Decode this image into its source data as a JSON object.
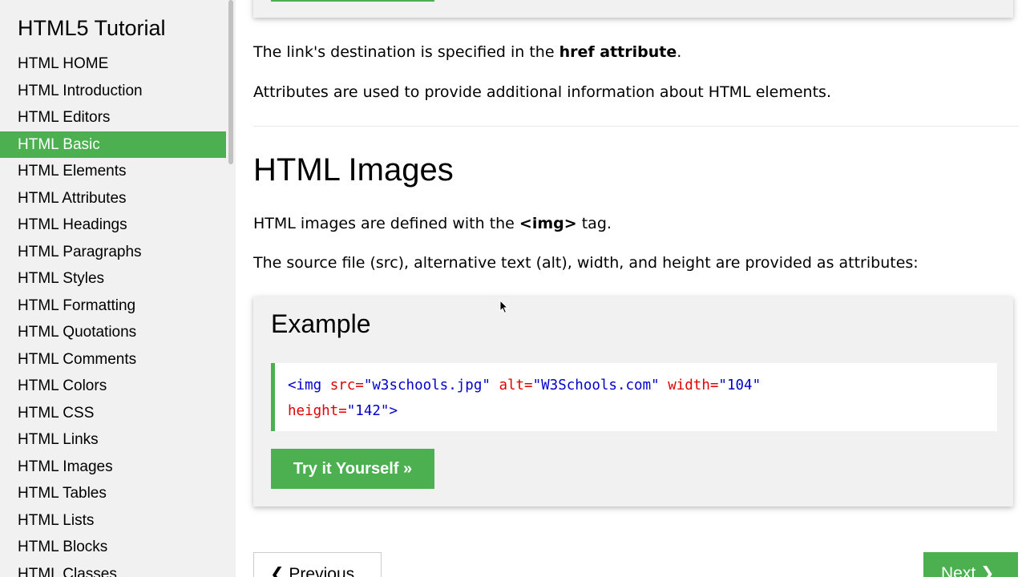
{
  "sidebar": {
    "title": "HTML5 Tutorial",
    "items": [
      {
        "label": "HTML HOME"
      },
      {
        "label": "HTML Introduction"
      },
      {
        "label": "HTML Editors"
      },
      {
        "label": "HTML Basic",
        "active": true
      },
      {
        "label": "HTML Elements"
      },
      {
        "label": "HTML Attributes"
      },
      {
        "label": "HTML Headings"
      },
      {
        "label": "HTML Paragraphs"
      },
      {
        "label": "HTML Styles"
      },
      {
        "label": "HTML Formatting"
      },
      {
        "label": "HTML Quotations"
      },
      {
        "label": "HTML Comments"
      },
      {
        "label": "HTML Colors"
      },
      {
        "label": "HTML CSS"
      },
      {
        "label": "HTML Links"
      },
      {
        "label": "HTML Images"
      },
      {
        "label": "HTML Tables"
      },
      {
        "label": "HTML Lists"
      },
      {
        "label": "HTML Blocks"
      },
      {
        "label": "HTML Classes"
      }
    ]
  },
  "main": {
    "para_link_prefix": "The link's destination is specified in the ",
    "para_link_bold": "href attribute",
    "para_link_suffix": ".",
    "para_attributes": "Attributes are used to provide additional information about HTML elements.",
    "heading": "HTML Images",
    "para_images_prefix": "HTML images are defined with the ",
    "para_images_bold": "<img>",
    "para_images_suffix": " tag.",
    "para_source": "The source file (src), alternative text (alt), width, and height are provided as attributes:",
    "example": {
      "title": "Example",
      "code": {
        "open": "<img",
        "attr_src": "src=",
        "val_src": "\"w3schools.jpg\"",
        "attr_alt": "alt=",
        "val_alt": "\"W3Schools.com\"",
        "attr_width": "width=",
        "val_width": "\"104\"",
        "attr_height": "height=",
        "val_height": "\"142\"",
        "close": ">"
      },
      "try_button": "Try it Yourself »"
    },
    "prev_button": "❮ Previous",
    "next_button": "Next ❯"
  },
  "colors": {
    "accent": "#4caf50",
    "code_tag": "#0000cd",
    "code_attr": "#e00000"
  }
}
